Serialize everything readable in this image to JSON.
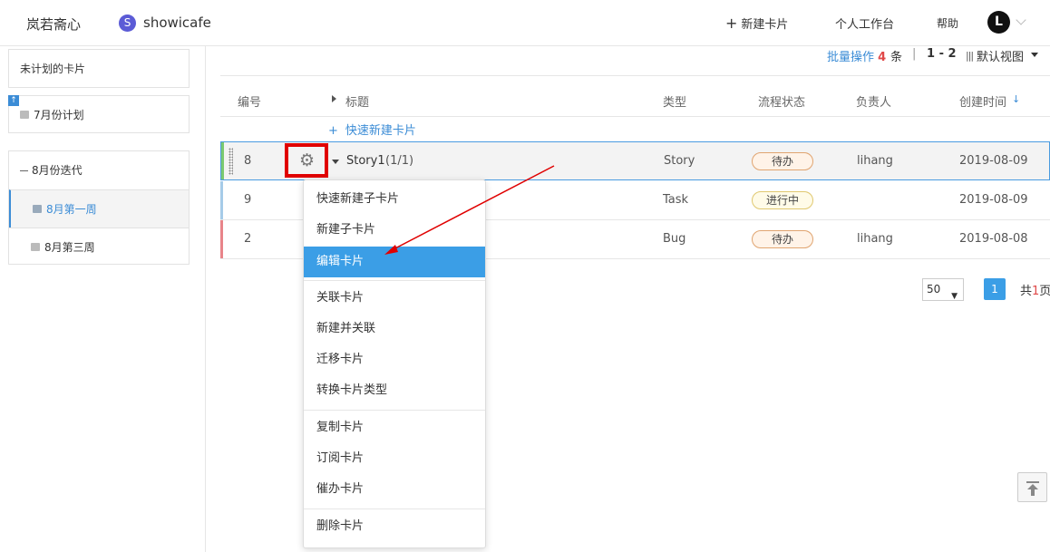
{
  "header": {
    "org_name": "岚若斋心",
    "project_logo_letter": "S",
    "project_name": "showicafe",
    "new_card": "新建卡片",
    "workbench": "个人工作台",
    "help": "帮助",
    "avatar_letter": "L"
  },
  "sidebar": {
    "unplanned": "未计划的卡片",
    "july_plan": "7月份计划",
    "aug_iteration": "8月份迭代",
    "aug_week1": "8月第一周",
    "aug_week3": "8月第三周"
  },
  "toolbar": {
    "batch_label": "批量操作",
    "batch_count": "4",
    "batch_unit": "条",
    "separator": "|",
    "range": "1 - 2",
    "view_label": "默认视图"
  },
  "table": {
    "columns": {
      "number": "编号",
      "title": "标题",
      "type": "类型",
      "status": "流程状态",
      "assignee": "负责人",
      "created": "创建时间"
    },
    "quick_new": "快速新建卡片",
    "rows": [
      {
        "number": "8",
        "title": "Story1",
        "child_count": "(1/1)",
        "type": "Story",
        "status": "待办",
        "assignee": "lihang",
        "created": "2019-08-09",
        "stripe": "#7bc96f"
      },
      {
        "number": "9",
        "title": "",
        "type": "Task",
        "status": "进行中",
        "assignee": "",
        "created": "2019-08-09",
        "stripe": "#a6cbe8"
      },
      {
        "number": "2",
        "title": "",
        "type": "Bug",
        "status": "待办",
        "assignee": "lihang",
        "created": "2019-08-08",
        "stripe": "#e8848a"
      }
    ]
  },
  "pagination": {
    "page_size": "50",
    "current_page": "1",
    "total_prefix": "共",
    "total_pages": "1",
    "total_suffix": "页"
  },
  "context_menu": {
    "items": [
      "快速新建子卡片",
      "新建子卡片",
      "编辑卡片",
      "关联卡片",
      "新建并关联",
      "迁移卡片",
      "转换卡片类型",
      "复制卡片",
      "订阅卡片",
      "催办卡片",
      "删除卡片"
    ],
    "highlighted_index": 2
  },
  "colors": {
    "accent": "#3b9ee6",
    "highlight_box": "#e00000",
    "arrow": "#e00000"
  },
  "icons": {
    "gear": "gear-icon",
    "back_to_top": "back-to-top-icon"
  }
}
